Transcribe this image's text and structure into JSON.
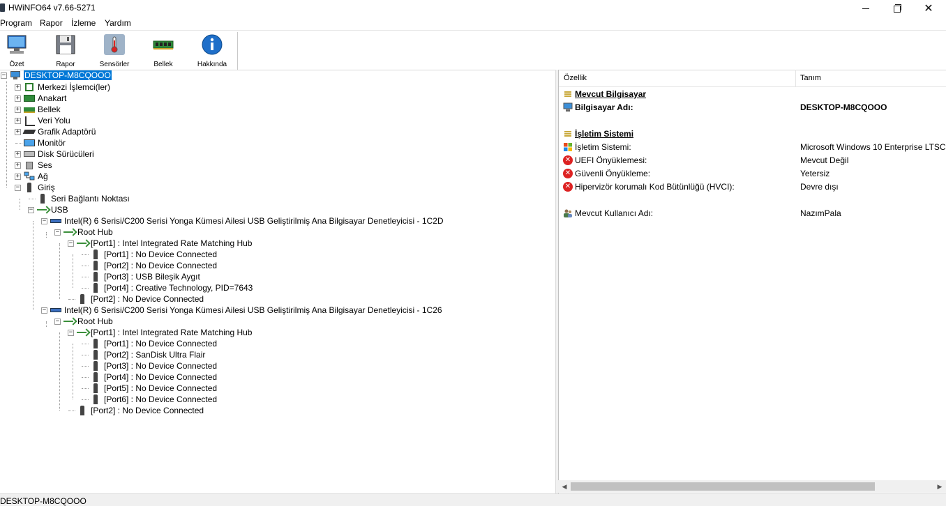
{
  "window": {
    "title": "HWiNFO64 v7.66-5271"
  },
  "menu": [
    "Program",
    "Rapor",
    "İzleme",
    "Yardım"
  ],
  "toolbar": [
    {
      "label": "Özet",
      "icon": "monitor-icon"
    },
    {
      "label": "Rapor",
      "icon": "floppy-disk-icon"
    },
    {
      "label": "Sensörler",
      "icon": "thermometer-icon"
    },
    {
      "label": "Bellek",
      "icon": "memory-module-icon"
    },
    {
      "label": "Hakkında",
      "icon": "info-icon"
    }
  ],
  "tree": [
    {
      "label": "DESKTOP-M8CQOOO",
      "icon": "computer-icon",
      "selected": true
    },
    {
      "label": "Merkezi İşlemci(ler)",
      "icon": "cpu-icon"
    },
    {
      "label": "Anakart",
      "icon": "motherboard-icon"
    },
    {
      "label": "Bellek",
      "icon": "ram-icon"
    },
    {
      "label": "Veri Yolu",
      "icon": "bus-icon"
    },
    {
      "label": "Grafik Adaptörü",
      "icon": "gpu-icon"
    },
    {
      "label": "Monitör",
      "icon": "monitor-icon"
    },
    {
      "label": "Disk Sürücüleri",
      "icon": "disk-icon"
    },
    {
      "label": "Ses",
      "icon": "speaker-icon"
    },
    {
      "label": "Ağ",
      "icon": "network-icon"
    },
    {
      "label": "Giriş",
      "icon": "plug-icon"
    },
    {
      "label": "Seri Bağlantı Noktası",
      "icon": "plug-icon"
    },
    {
      "label": "USB",
      "icon": "usb-icon"
    },
    {
      "label": "Intel(R) 6 Serisi/C200 Serisi Yonga Kümesi Ailesi USB Geliştirilmiş Ana Bilgisayar Denetleyicisi - 1C2D",
      "icon": "usb-controller-icon"
    },
    {
      "label": "Root Hub",
      "icon": "usb-icon"
    },
    {
      "label": "[Port1] : Intel Integrated Rate Matching Hub",
      "icon": "usb-icon"
    },
    {
      "label": "[Port1] : No Device Connected",
      "icon": "plug-icon"
    },
    {
      "label": "[Port2] : No Device Connected",
      "icon": "plug-icon"
    },
    {
      "label": "[Port3] : USB Bileşik Aygıt",
      "icon": "plug-icon"
    },
    {
      "label": "[Port4] : Creative Technology, PID=7643",
      "icon": "plug-icon"
    },
    {
      "label": "[Port2] : No Device Connected",
      "icon": "plug-icon"
    },
    {
      "label": "Intel(R) 6 Serisi/C200 Serisi Yonga Kümesi Ailesi USB Geliştirilmiş Ana Bilgisayar Denetleyicisi - 1C26",
      "icon": "usb-controller-icon"
    },
    {
      "label": "Root Hub",
      "icon": "usb-icon"
    },
    {
      "label": "[Port1] : Intel Integrated Rate Matching Hub",
      "icon": "usb-icon"
    },
    {
      "label": "[Port1] : No Device Connected",
      "icon": "plug-icon"
    },
    {
      "label": "[Port2] : SanDisk Ultra Flair",
      "icon": "plug-icon"
    },
    {
      "label": "[Port3] : No Device Connected",
      "icon": "plug-icon"
    },
    {
      "label": "[Port4] : No Device Connected",
      "icon": "plug-icon"
    },
    {
      "label": "[Port5] : No Device Connected",
      "icon": "plug-icon"
    },
    {
      "label": "[Port6] : No Device Connected",
      "icon": "plug-icon"
    },
    {
      "label": "[Port2] : No Device Connected",
      "icon": "plug-icon"
    }
  ],
  "details": {
    "columns": [
      "Özellik",
      "Tanım"
    ],
    "rows": [
      {
        "type": "section",
        "name": "Mevcut Bilgisayar",
        "icon": "section-icon"
      },
      {
        "type": "bold",
        "name": "Bilgisayar Adı:",
        "value": "DESKTOP-M8CQOOO",
        "icon": "computer-icon"
      },
      {
        "type": "section",
        "name": "İşletim Sistemi",
        "icon": "section-icon"
      },
      {
        "type": "normal",
        "name": "İşletim Sistemi:",
        "value": "Microsoft Windows 10 Enterprise LTSC",
        "icon": "windows-logo-icon"
      },
      {
        "type": "normal",
        "name": "UEFI Önyüklemesi:",
        "value": "Mevcut Değil",
        "icon": "error-icon"
      },
      {
        "type": "normal",
        "name": "Güvenli Önyükleme:",
        "value": "Yetersiz",
        "icon": "error-icon"
      },
      {
        "type": "normal",
        "name": "Hipervizör korumalı Kod Bütünlüğü (HVCI):",
        "value": "Devre dışı",
        "icon": "error-icon"
      },
      {
        "type": "normal",
        "name": "Mevcut Kullanıcı Adı:",
        "value": "NazımPala",
        "icon": "users-icon"
      }
    ]
  },
  "statusbar": {
    "text": "DESKTOP-M8CQOOO"
  }
}
